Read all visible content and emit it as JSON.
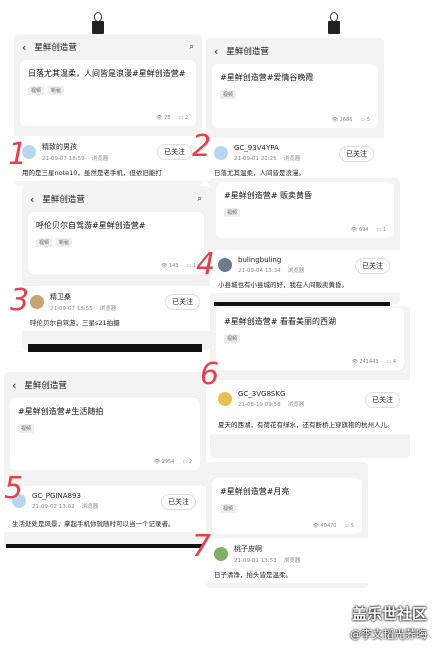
{
  "app": {
    "title": "星鲜创造营",
    "search_icon": "search-icon",
    "back_icon": "back-arrow-icon"
  },
  "shots": [
    {
      "post_text": "日落尤其温柔，人间皆是浪漫#星鲜创造营#",
      "tags": [
        "视频",
        "新秘"
      ],
      "views": "78",
      "comments": "2",
      "user": "精致的男孩",
      "meta": "21-09-07 18:59 　浏览器",
      "follow": "已关注",
      "comment": "用的是三星note10，虽然是老手机，但依旧能打",
      "num": "1"
    },
    {
      "post_text": "#星鲜创造营#爱情谷晚霞",
      "tags": [
        "视频"
      ],
      "views": "2686",
      "comments": "5",
      "user": "GC_93V4YPA",
      "meta": "21-09-01 21:25 　浏览器",
      "follow": "已关注",
      "comment": "日落尤其温柔，人间皆是浪漫。",
      "num": "2"
    },
    {
      "post_text": "呼伦贝尔自驾游#星鲜创造营#",
      "tags": [
        "视频",
        "新秘"
      ],
      "views": "143",
      "comments": "1",
      "user": "精卫桑",
      "meta": "21-09-07 18:55 　浏览器",
      "follow": "已关注",
      "comment": "呼伦贝尔自驾游，三星s21拍摄",
      "num": "3"
    },
    {
      "post_text": "#星鲜创造营# 贩卖黄昏",
      "tags": [
        "视频"
      ],
      "views": "694",
      "comments": "1",
      "user": "bulingbuling",
      "meta": "21-09-04 13:34 　浏览器",
      "follow": "已关注",
      "comment": "小县城也有小县城的好，我在人间贩卖黄昏。",
      "num": "4"
    },
    {
      "post_text": "#星鲜创造营# 看看美丽的西湖",
      "tags": [
        "视频"
      ],
      "views": "241443",
      "comments": "4",
      "user": "GC_3VG8SKG",
      "meta": "21-08-19 09:58 　浏览器",
      "follow": "已关注",
      "comment": "夏天的西湖，有荷花有绿水，还有断桥上穿旗袍的杭州人儿。",
      "num": "6"
    },
    {
      "post_text": "#星鲜创造营#生活随拍",
      "tags": [
        "视频"
      ],
      "views": "2954",
      "comments": "2",
      "user": "GC_PGINA893",
      "meta": "21-09-02 13:02 　浏览器",
      "follow": "已关注",
      "comment": "生活处处是风景，拿起手机你就随时可以当一个记录者。",
      "num": "5"
    },
    {
      "post_text": "#星鲜创造营#月亮",
      "tags": [
        "视频"
      ],
      "views": "40470",
      "comments": "5",
      "user": "桃子皮啊",
      "meta": "21-09-01 13:53 　浏览器",
      "follow": "已关注",
      "comment": "日子清净，抬头皆是温柔。",
      "num": "7"
    }
  ],
  "watermark": {
    "line1": "盖乐世社区",
    "line2": "@李文韬光荞晦"
  }
}
